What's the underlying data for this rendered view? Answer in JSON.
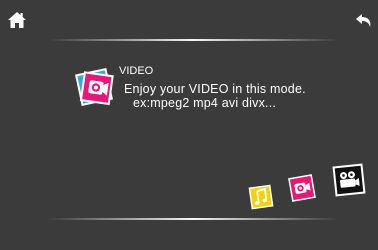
{
  "header": {
    "home_icon": "home-icon",
    "back_icon": "back-arrow-icon"
  },
  "mode": {
    "title": "VIDEO",
    "description_line1": "Enjoy your VIDEO in this mode.",
    "description_line2": "ex:mpeg2 mp4 avi divx...",
    "icon": "video-camera-icon"
  },
  "mode_selector": {
    "items": [
      {
        "icon": "music-note-icon",
        "color": "#f5d10b"
      },
      {
        "icon": "video-camera-icon",
        "color": "#e6187a"
      },
      {
        "icon": "movie-camera-icon",
        "color": "#111111"
      }
    ]
  },
  "colors": {
    "background": "#3b3b3b",
    "accent_pink": "#e6187a",
    "accent_blue": "#3aa6e0",
    "accent_yellow": "#f5d10b"
  }
}
